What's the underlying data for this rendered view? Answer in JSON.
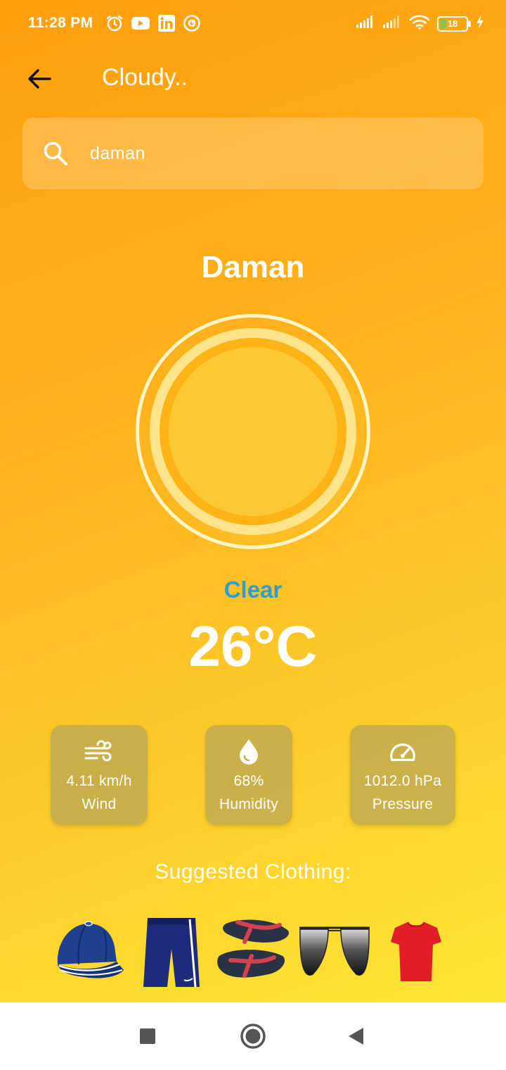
{
  "status_bar": {
    "time": "11:28 PM",
    "battery": "18",
    "left_icons": [
      "alarm-icon",
      "youtube-icon",
      "linkedin-icon",
      "at-sign-icon"
    ],
    "right_icons": [
      "signal-icon",
      "signal-icon",
      "wifi-icon",
      "battery-icon",
      "charging-icon"
    ]
  },
  "app_bar": {
    "title": "Cloudy..",
    "back_icon": "arrow-left-icon"
  },
  "search": {
    "value": "daman",
    "icon": "search-icon"
  },
  "weather": {
    "city": "Daman",
    "condition": "Clear",
    "temperature": "26°C",
    "condition_color": "#2a9fd0"
  },
  "stats": {
    "wind": {
      "value": "4.11 km/h",
      "label": "Wind",
      "icon": "wind-icon"
    },
    "humidity": {
      "value": "68%",
      "label": "Humidity",
      "icon": "water-drop-icon"
    },
    "pressure": {
      "value": "1012.0 hPa",
      "label": "Pressure",
      "icon": "speedometer-icon"
    }
  },
  "clothing": {
    "title": "Suggested Clothing:",
    "items": [
      "cap",
      "shorts",
      "flip-flops",
      "sunglasses",
      "t-shirt"
    ]
  },
  "nav_bar": {
    "buttons": [
      "recents-square-icon",
      "home-circle-icon",
      "back-triangle-icon"
    ]
  },
  "colors": {
    "gradient_top": "#ff9f0a",
    "gradient_bottom": "#fde733",
    "card_bg": "#beaa50"
  }
}
